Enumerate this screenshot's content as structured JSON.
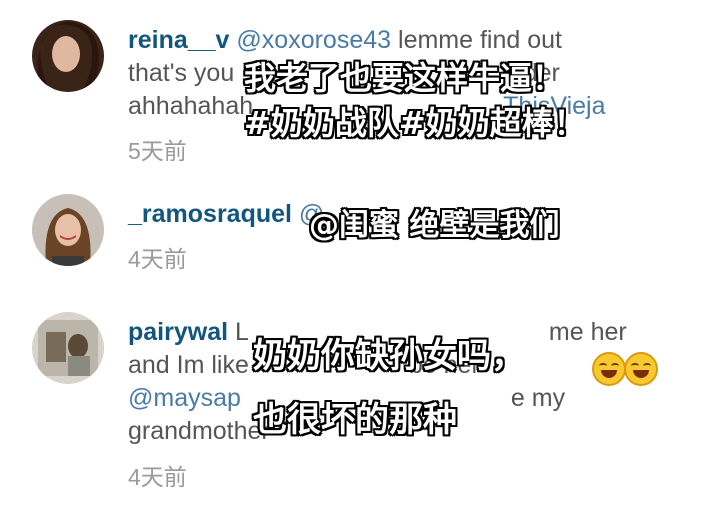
{
  "comments": [
    {
      "username": "reina__v",
      "lines": [
        [
          "@xoxorose43",
          "  lemme find out"
        ],
        [
          "that's you",
          "",
          "older"
        ],
        [
          "ahhahahah",
          "",
          "ThisVieja"
        ]
      ],
      "time": "5天前",
      "overlay": [
        "我老了也要这样牛逼！",
        "#奶奶战队#奶奶超棒！"
      ]
    },
    {
      "username": "_ramosraquel",
      "lines": [
        [
          "@"
        ]
      ],
      "time": "4天前",
      "overlay": [
        "@闺蜜 绝壁是我们"
      ]
    },
    {
      "username": "pairywal",
      "lines": [
        [
          "L",
          "me her"
        ],
        [
          "and Im like",
          "be her"
        ],
        [
          "@maysap",
          "e my"
        ],
        [
          "grandmother"
        ]
      ],
      "time": "4天前",
      "overlay": [
        "奶奶你缺孙女吗，",
        "也很坏的那种"
      ]
    }
  ],
  "colors": {
    "username": "#12557f",
    "mention": "#4a7ba6",
    "body_text": "#555555",
    "timestamp": "#9a9a9a"
  },
  "icons": [
    "tears-of-joy-emoji",
    "tears-of-joy-emoji"
  ]
}
